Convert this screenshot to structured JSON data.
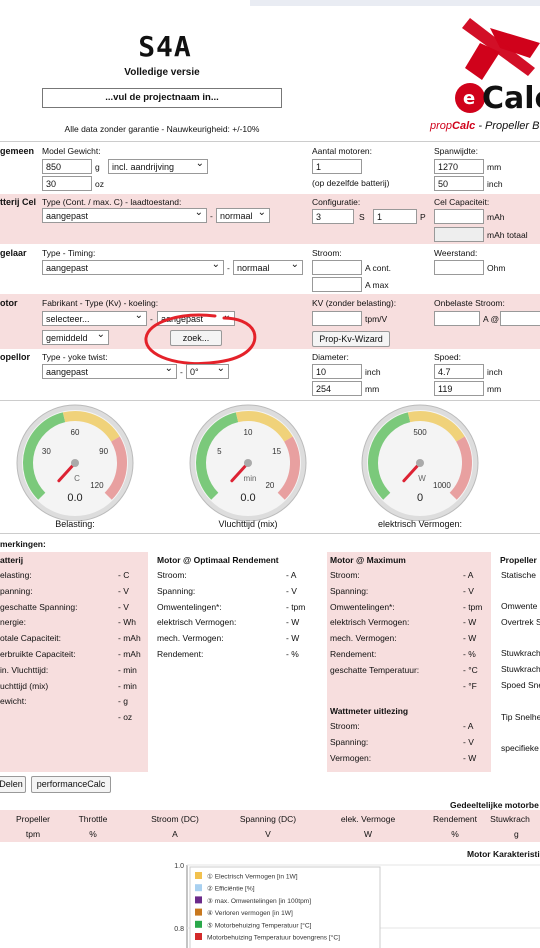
{
  "header": {
    "logo_s4a": "S4A",
    "version": "Volledige versie",
    "project_placeholder": "...vul de projectnaam in...",
    "disclaimer": "Alle data zonder garantie - Nauwkeurigheid: +/-10%",
    "brand_prefix": "prop",
    "brand_calc": "Calc",
    "brand_suffix": " - Propeller B",
    "ecalc_logo": "eCalc"
  },
  "algemeen": {
    "section": "gemeen",
    "model_weight_label": "Model Gewicht:",
    "weight_value": "850",
    "weight_unit": "g",
    "weight_mode": "incl. aandrijving",
    "weight_oz": "30",
    "oz_unit": "oz",
    "motors_label": "Aantal motoren:",
    "motors_value": "1",
    "motors_note": "(op dezelfde batterij)",
    "span_label": "Spanwijdte:",
    "span_mm": "1270",
    "span_mm_unit": "mm",
    "span_inch": "50",
    "span_inch_unit": "inch"
  },
  "batterij": {
    "section": "tterij Cel",
    "type_label": "Type (Cont. / max. C) - laadtoestand:",
    "type_value": "aangepast",
    "state_value": "normaal",
    "config_label": "Configuratie:",
    "s_value": "3",
    "s_unit": "S",
    "p_value": "1",
    "p_unit": "P",
    "capacity_label": "Cel Capaciteit:",
    "mah_unit": "mAh",
    "mah_total_unit": "mAh totaal"
  },
  "regelaar": {
    "section": "gelaar",
    "type_label": "Type - Timing:",
    "type_value": "aangepast",
    "timing_value": "normaal",
    "current_label": "Stroom:",
    "cont_unit": "A cont.",
    "max_unit": "A max",
    "resistance_label": "Weerstand:",
    "ohm_unit": "Ohm"
  },
  "motor": {
    "section": "otor",
    "maker_label": "Fabrikant - Type (Kv) - koeling:",
    "maker_value": "selecteer...",
    "type_value": "aangepast",
    "cooling_value": "gemiddeld",
    "search_button": "zoek...",
    "kv_label": "KV (zonder belasting):",
    "kv_unit": "tpm/V",
    "kv_wizard": "Prop-Kv-Wizard",
    "noload_label": "Onbelaste Stroom:",
    "a_at": "A @"
  },
  "propeller": {
    "section": "opellor",
    "type_label": "Type - yoke twist:",
    "type_value": "aangepast",
    "twist_value": "0°",
    "diameter_label": "Diameter:",
    "diameter_inch": "10",
    "inch_unit": "inch",
    "diameter_mm": "254",
    "mm_unit": "mm",
    "pitch_label": "Spoed:",
    "pitch_inch": "4.7",
    "pitch_mm": "119"
  },
  "gauges": [
    {
      "caption": "Belasting:",
      "unit": "C",
      "value": "0.0",
      "ticks": [
        "30",
        "60",
        "90",
        "120"
      ],
      "reading": 0
    },
    {
      "caption": "Vluchttijd (mix)",
      "unit": "min",
      "value": "0.0",
      "ticks": [
        "5",
        "10",
        "15",
        "20"
      ],
      "reading": 0
    },
    {
      "caption": "elektrisch Vermogen:",
      "unit": "W",
      "value": "0",
      "ticks": [
        "500",
        "1000"
      ],
      "reading": 0
    }
  ],
  "results": {
    "remarks": "merkingen:",
    "battery": {
      "title": "atterij",
      "rows": [
        {
          "label": "elasting:",
          "value": "- C"
        },
        {
          "label": "panning:",
          "value": "- V"
        },
        {
          "label": "geschatte Spanning:",
          "value": "- V"
        },
        {
          "label": "nergie:",
          "value": "- Wh"
        },
        {
          "label": "otale Capaciteit:",
          "value": "- mAh"
        },
        {
          "label": "erbruikte Capaciteit:",
          "value": "- mAh"
        },
        {
          "label": "in. Vluchttijd:",
          "value": "- min"
        },
        {
          "label": "uchttijd (mix)",
          "value": "- min"
        },
        {
          "label": "ewicht:",
          "value": "- g"
        },
        {
          "label": "",
          "value": "- oz"
        }
      ]
    },
    "motor_opt": {
      "title": "Motor @ Optimaal Rendement",
      "rows": [
        {
          "label": "Stroom:",
          "value": "- A"
        },
        {
          "label": "Spanning:",
          "value": "- V"
        },
        {
          "label": "Omwentelingen*:",
          "value": "- tpm"
        },
        {
          "label": "elektrisch Vermogen:",
          "value": "- W"
        },
        {
          "label": "mech. Vermogen:",
          "value": "- W"
        },
        {
          "label": "Rendement:",
          "value": "- %"
        }
      ]
    },
    "motor_max": {
      "title": "Motor @ Maximum",
      "rows": [
        {
          "label": "Stroom:",
          "value": "- A"
        },
        {
          "label": "Spanning:",
          "value": "- V"
        },
        {
          "label": "Omwentelingen*:",
          "value": "- tpm"
        },
        {
          "label": "elektrisch Vermogen:",
          "value": "- W"
        },
        {
          "label": "mech. Vermogen:",
          "value": "- W"
        },
        {
          "label": "Rendement:",
          "value": "- %"
        },
        {
          "label": "geschatte Temperatuur:",
          "value": "- °C"
        },
        {
          "label": "",
          "value": "- °F"
        }
      ]
    },
    "wattmeter": {
      "title": "Wattmeter uitlezing",
      "rows": [
        {
          "label": "Stroom:",
          "value": "- A"
        },
        {
          "label": "Spanning:",
          "value": "- V"
        },
        {
          "label": "Vermogen:",
          "value": "- W"
        }
      ]
    },
    "propeller": {
      "title": "Propeller",
      "rows": [
        "Statische",
        "Omwente",
        "Overtrek S",
        "Stuwkrach",
        "Stuwkrach",
        "Spoed Sne",
        "Tip Snelhe",
        "specifieke"
      ]
    }
  },
  "buttons": {
    "share": "Delen",
    "perfcalc": "performanceCalc"
  },
  "partial_table": {
    "title": "Gedeeltelijke motorbe",
    "headers": [
      "Propeller",
      "Throttle",
      "Stroom (DC)",
      "Spanning (DC)",
      "elek. Vermoge",
      "Rendement",
      "Stuwkrach"
    ],
    "units": [
      "tpm",
      "%",
      "A",
      "V",
      "W",
      "%",
      "g"
    ]
  },
  "chart_data": {
    "type": "line",
    "title": "Motor Karakteristi",
    "ylim": [
      0.8,
      1.0
    ],
    "yticks": [
      "1.0",
      "0.8"
    ],
    "legend": [
      {
        "name": "① Electrisch Vermogen [in 1W]",
        "color": "#f2c14e"
      },
      {
        "name": "② Efficiëntie [%]",
        "color": "#a8d0f0"
      },
      {
        "name": "③ max. Omwentelingen [in 100tpm]",
        "color": "#6b2a8a"
      },
      {
        "name": "④ Verloren vermogen [in 1W]",
        "color": "#c8781e"
      },
      {
        "name": "⑤ Motorbehuizing Temperatuur [°C]",
        "color": "#2aa84a"
      },
      {
        "name": "Motorbehuizing Temperatuur bovengrens [°C]",
        "color": "#d32a2a"
      }
    ],
    "series": []
  },
  "colors": {
    "band": "#f7dede",
    "brand_red": "#d0021b",
    "gauge_green": "#7bc97b",
    "gauge_yellow": "#f0d27a",
    "gauge_red": "#e8a0a0"
  }
}
